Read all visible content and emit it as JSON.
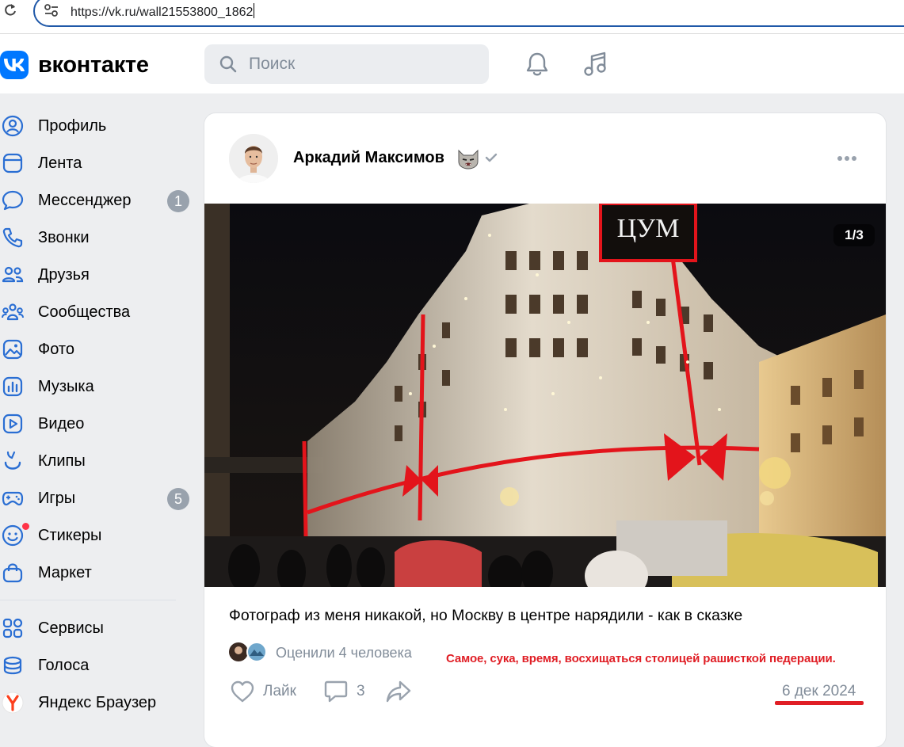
{
  "browser": {
    "url": "https://vk.ru/wall21553800_1862"
  },
  "header": {
    "logo_text": "вконтакте",
    "search_placeholder": "Поиск"
  },
  "sidebar": {
    "items": [
      {
        "label": "Профиль",
        "icon": "profile-icon"
      },
      {
        "label": "Лента",
        "icon": "feed-icon"
      },
      {
        "label": "Мессенджер",
        "icon": "messenger-icon",
        "badge": "1"
      },
      {
        "label": "Звонки",
        "icon": "phone-icon"
      },
      {
        "label": "Друзья",
        "icon": "friends-icon"
      },
      {
        "label": "Сообщества",
        "icon": "communities-icon"
      },
      {
        "label": "Фото",
        "icon": "photo-icon"
      },
      {
        "label": "Музыка",
        "icon": "music-icon"
      },
      {
        "label": "Видео",
        "icon": "video-icon"
      },
      {
        "label": "Клипы",
        "icon": "clips-icon"
      },
      {
        "label": "Игры",
        "icon": "games-icon",
        "badge": "5"
      },
      {
        "label": "Стикеры",
        "icon": "stickers-icon"
      },
      {
        "label": "Маркет",
        "icon": "market-icon"
      }
    ],
    "extra_items": [
      {
        "label": "Сервисы",
        "icon": "services-icon"
      },
      {
        "label": "Голоса",
        "icon": "votes-icon"
      },
      {
        "label": "Яндекс Браузер",
        "icon": "yandex-browser-icon"
      }
    ]
  },
  "post": {
    "author": "Аркадий Максимов",
    "photo_counter": "1/3",
    "text": "Фотограф из меня никакой, но Москву в центре нарядили - как в сказке",
    "liked_by": "Оценили 4 человека",
    "like_label": "Лайк",
    "comments_count": "3",
    "date": "6 дек 2024",
    "sign_text": "ЦУМ"
  },
  "annotation": {
    "text": "Самое, сука, время, восхищаться столицей рашисткой педерации.",
    "color": "#e01e25"
  },
  "colors": {
    "brand": "#0077ff",
    "muted": "#818c99",
    "background": "#edeef0"
  }
}
